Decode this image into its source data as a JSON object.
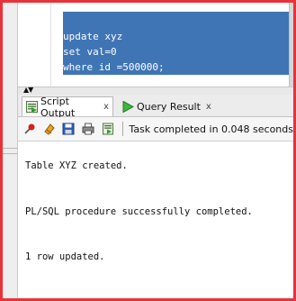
{
  "editor": {
    "code_lines": [
      "update xyz",
      "set val=0",
      "where id =500000;"
    ]
  },
  "output_panel": {
    "tabs": [
      {
        "label": "Script Output",
        "close": "x",
        "icon": "script-output-icon"
      },
      {
        "label": "Query Result",
        "close": "x",
        "icon": "query-result-icon"
      }
    ],
    "toolbar": {
      "buttons": [
        "pin-icon",
        "eraser-icon",
        "save-icon",
        "print-icon",
        "open-file-icon"
      ],
      "status": "Task completed in 0.048 seconds"
    },
    "lines": [
      "Table XYZ created.",
      "PL/SQL procedure successfully completed.",
      "1 row updated."
    ]
  },
  "colors": {
    "frame": "#e8323a",
    "selection": "#3f75b5"
  }
}
